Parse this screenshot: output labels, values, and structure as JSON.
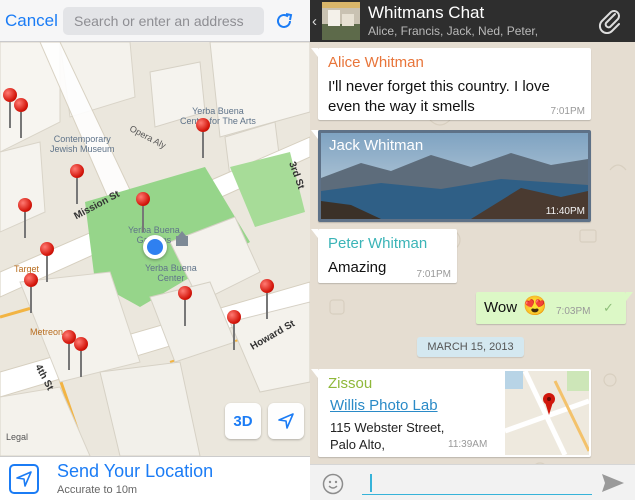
{
  "map_screen": {
    "cancel_label": "Cancel",
    "search_placeholder": "Search or enter an address",
    "refresh_icon": "refresh-icon",
    "labels": {
      "museum": "Contemporary\nJewish Museum",
      "yerba_arts": "Yerba Buena\nCenter for The Arts",
      "yerba_gardens": "Yerba Buena\nGardens",
      "yerba_center": "Yerba Buena\nCenter",
      "target": "Target",
      "metreon": "Metreon"
    },
    "streets": {
      "opera": "Opera Aly",
      "mission": "Mission St",
      "third": "3rd St",
      "howard": "Howard St",
      "fourth": "4th St"
    },
    "btn_3d": "3D",
    "legal": "Legal",
    "send_location": {
      "title": "Send Your Location",
      "subtitle": "Accurate to 10m"
    },
    "colors": {
      "accent": "#1b7cf5",
      "pin": "#d3150a",
      "park": "#96d58a"
    }
  },
  "chat": {
    "title": "Whitmans Chat",
    "members": "Alice, Francis, Jack, Ned, Peter,",
    "messages": [
      {
        "sender": "Alice Whitman",
        "sender_color": "#e8753a",
        "text": "I'll never forget this country. I love even the way it smells",
        "time": "7:01PM"
      },
      {
        "sender": "Jack Whitman",
        "type": "image",
        "time": "11:40PM"
      },
      {
        "sender": "Peter Whitman",
        "sender_color": "#3bb4b7",
        "text": "Amazing",
        "time": "7:01PM"
      },
      {
        "outgoing": true,
        "text": "Wow",
        "emoji": "😍",
        "time": "7:03PM",
        "status": "✓"
      },
      {
        "sender": "Zissou",
        "sender_color": "#8fb83a",
        "type": "location",
        "place": "Willis Photo Lab",
        "address": "115 Webster Street, Palo Alto,",
        "time": "11:39AM"
      }
    ],
    "date_divider": "MARCH 15, 2013",
    "composer": {
      "emoji_icon": "smiley-icon",
      "send_icon": "send-icon"
    },
    "colors": {
      "header": "#2e2e2e",
      "outgoing_bubble": "#dcf8c6",
      "date_pill": "#d4e8f0"
    }
  }
}
